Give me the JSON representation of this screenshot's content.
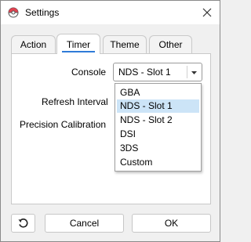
{
  "window": {
    "title": "Settings"
  },
  "tabs": [
    {
      "label": "Action",
      "active": false
    },
    {
      "label": "Timer",
      "active": true
    },
    {
      "label": "Theme",
      "active": false
    },
    {
      "label": "Other",
      "active": false
    }
  ],
  "timer": {
    "console_label": "Console",
    "console_value": "NDS - Slot 1",
    "refresh_label": "Refresh Interval",
    "precision_label": "Precision Calibration"
  },
  "console_options": [
    "GBA",
    "NDS - Slot 1",
    "NDS - Slot 2",
    "DSI",
    "3DS",
    "Custom"
  ],
  "footer": {
    "reset_icon": "undo-icon",
    "cancel_label": "Cancel",
    "ok_label": "OK"
  },
  "colors": {
    "accent": "#2f7bd8",
    "selected_bg": "#cce4f7",
    "window_bg": "#f0f0f0"
  }
}
